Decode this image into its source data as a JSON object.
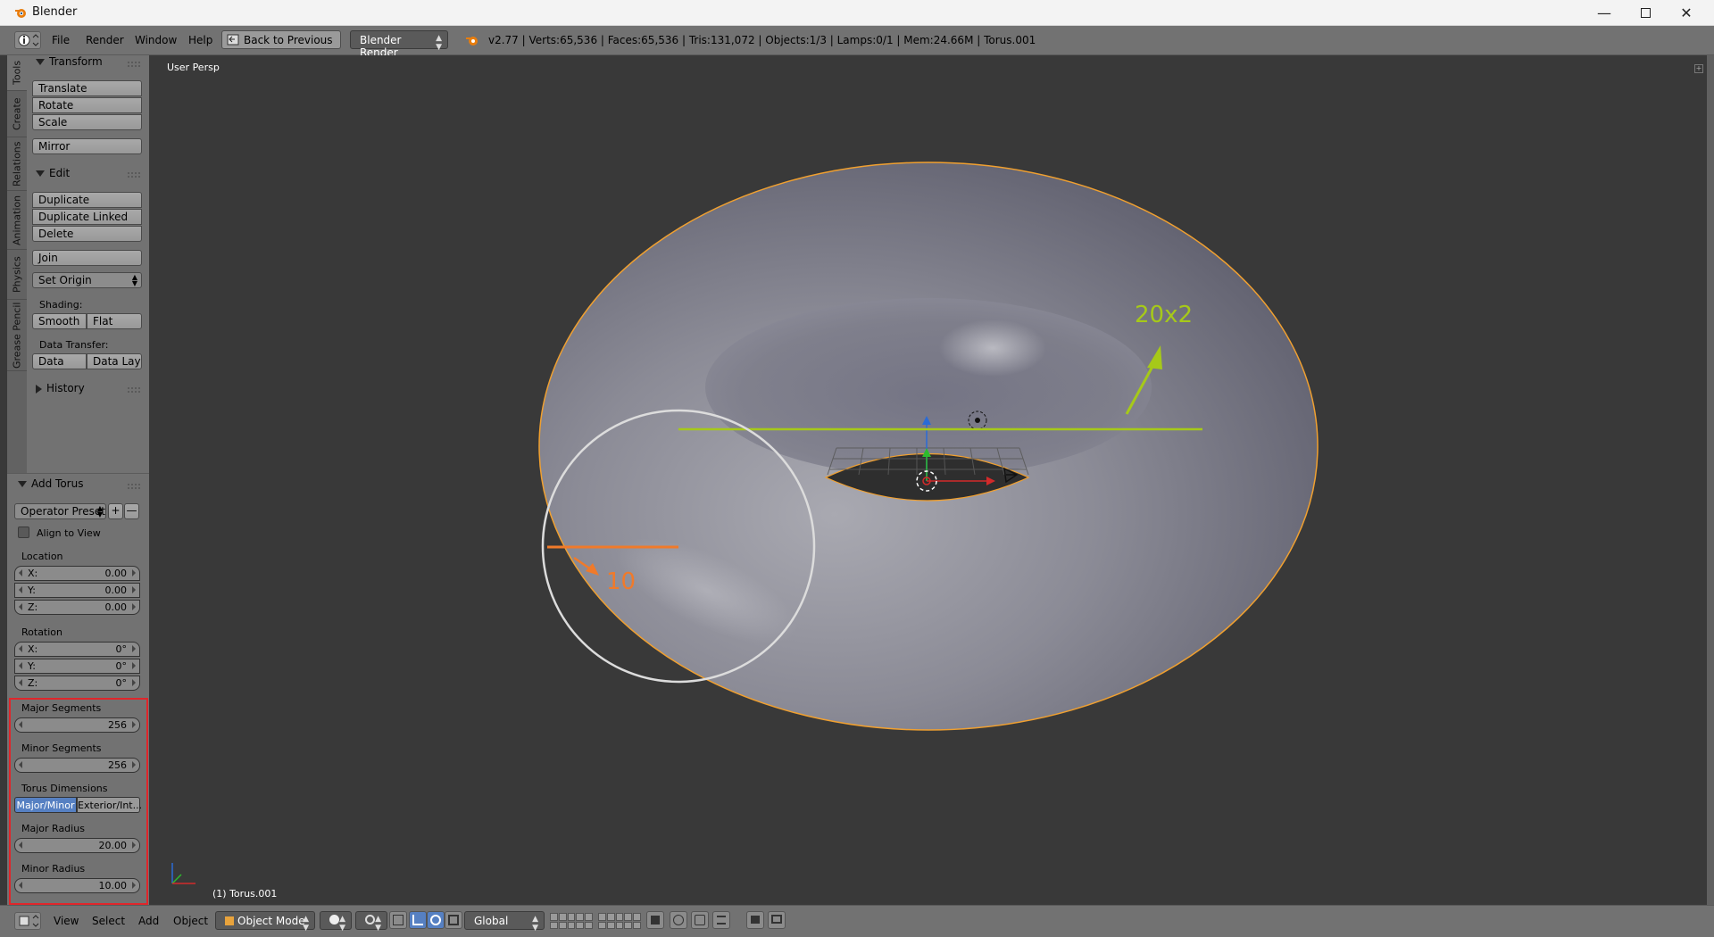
{
  "window": {
    "title": "Blender"
  },
  "infobar": {
    "menus": [
      "File",
      "Render",
      "Window",
      "Help"
    ],
    "back_button": "Back to Previous",
    "render_engine": "Blender Render",
    "stats": "v2.77 | Verts:65,536 | Faces:65,536 | Tris:131,072 | Objects:1/3 | Lamps:0/1 | Mem:24.66M | Torus.001"
  },
  "side_tabs": [
    "Tools",
    "Create",
    "Relations",
    "Animation",
    "Physics",
    "Grease Pencil"
  ],
  "toolshelf": {
    "transform": {
      "title": "Transform",
      "buttons": [
        "Translate",
        "Rotate",
        "Scale",
        "Mirror"
      ]
    },
    "edit": {
      "title": "Edit",
      "buttons": [
        "Duplicate",
        "Duplicate Linked",
        "Delete",
        "Join"
      ],
      "set_origin": "Set Origin",
      "shading_label": "Shading:",
      "shading": [
        "Smooth",
        "Flat"
      ],
      "data_transfer_label": "Data Transfer:",
      "data_transfer": [
        "Data",
        "Data Layo"
      ]
    },
    "history": {
      "title": "History"
    }
  },
  "operator": {
    "title": "Add Torus",
    "presets": "Operator Presets",
    "align_to_view": "Align to View",
    "location": {
      "label": "Location",
      "x": "0.00",
      "y": "0.00",
      "z": "0.00"
    },
    "rotation": {
      "label": "Rotation",
      "x": "0°",
      "y": "0°",
      "z": "0°"
    },
    "axis": {
      "x": "X:",
      "y": "Y:",
      "z": "Z:"
    },
    "major_segments": {
      "label": "Major Segments",
      "value": "256"
    },
    "minor_segments": {
      "label": "Minor Segments",
      "value": "256"
    },
    "torus_dimensions": {
      "label": "Torus Dimensions",
      "options": [
        "Major/Minor",
        "Exterior/Int..."
      ],
      "selected": "Major/Minor"
    },
    "major_radius": {
      "label": "Major Radius",
      "value": "20.00"
    },
    "minor_radius": {
      "label": "Minor Radius",
      "value": "10.00"
    }
  },
  "viewport": {
    "view_label": "User Persp",
    "object_label": "(1) Torus.001",
    "annotation_major": "20x2",
    "annotation_minor": "10",
    "colors": {
      "selection": "#f0a030",
      "annotation_green": "#a6c919",
      "annotation_orange": "#f07a2a"
    }
  },
  "bottombar": {
    "menus": [
      "View",
      "Select",
      "Add",
      "Object"
    ],
    "mode": "Object Mode",
    "orientation": "Global"
  }
}
